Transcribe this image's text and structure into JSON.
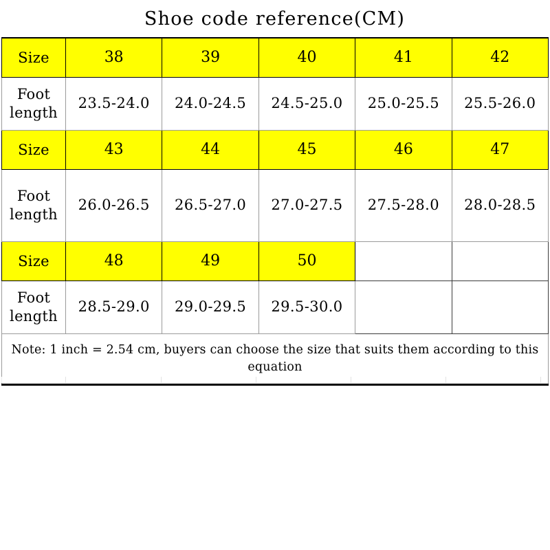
{
  "title": "Shoe code reference(CM)",
  "labels": {
    "size": "Size",
    "foot_line1": "Foot",
    "foot_line2": "length"
  },
  "colors": {
    "highlight": "#FFFF00",
    "text": "#000000",
    "background": "#FFFFFF",
    "border": "#000000"
  },
  "note": {
    "line1": "Note: 1 inch = 2.54 cm, buyers can choose the size that suits them according to",
    "line2": "this equation"
  },
  "chart_data": {
    "type": "table",
    "title": "Shoe code reference(CM)",
    "columns": 6,
    "blocks": [
      {
        "sizes": [
          "38",
          "39",
          "40",
          "41",
          "42"
        ],
        "foot_lengths": [
          "23.5-24.0",
          "24.0-24.5",
          "24.5-25.0",
          "25.0-25.5",
          "25.5-26.0"
        ]
      },
      {
        "sizes": [
          "43",
          "44",
          "45",
          "46",
          "47"
        ],
        "foot_lengths": [
          "26.0-26.5",
          "26.5-27.0",
          "27.0-27.5",
          "27.5-28.0",
          "28.0-28.5"
        ]
      },
      {
        "sizes": [
          "48",
          "49",
          "50",
          "",
          ""
        ],
        "foot_lengths": [
          "28.5-29.0",
          "29.0-29.5",
          "29.5-30.0",
          "",
          ""
        ]
      }
    ],
    "note": "Note: 1 inch = 2.54 cm, buyers can choose the size that suits them according to this equation"
  },
  "rows": {
    "block1": {
      "size_label": "Size",
      "s1": "38",
      "s2": "39",
      "s3": "40",
      "s4": "41",
      "s5": "42",
      "f1": "23.5-24.0",
      "f2": "24.0-24.5",
      "f3": "24.5-25.0",
      "f4": "25.0-25.5",
      "f5": "25.5-26.0"
    },
    "block2": {
      "size_label": "Size",
      "s1": "43",
      "s2": "44",
      "s3": "45",
      "s4": "46",
      "s5": "47",
      "f1": "26.0-26.5",
      "f2": "26.5-27.0",
      "f3": "27.0-27.5",
      "f4": "27.5-28.0",
      "f5": "28.0-28.5"
    },
    "block3": {
      "size_label": "Size",
      "s1": "48",
      "s2": "49",
      "s3": "50",
      "s4": "",
      "s5": "",
      "f1": "28.5-29.0",
      "f2": "29.0-29.5",
      "f3": "29.5-30.0",
      "f4": "",
      "f5": ""
    }
  }
}
